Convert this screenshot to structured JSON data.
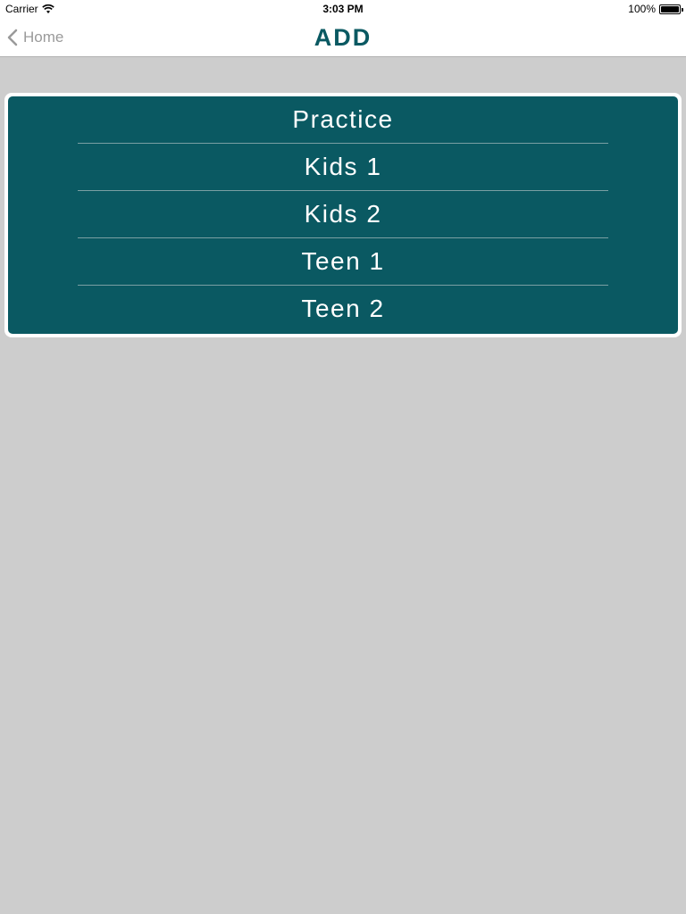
{
  "status_bar": {
    "carrier": "Carrier",
    "time": "3:03 PM",
    "battery": "100%"
  },
  "nav": {
    "back_label": "Home",
    "title": "ADD"
  },
  "menu": {
    "items": [
      {
        "label": "Practice"
      },
      {
        "label": "Kids 1"
      },
      {
        "label": "Kids 2"
      },
      {
        "label": "Teen 1"
      },
      {
        "label": "Teen 2"
      }
    ]
  },
  "colors": {
    "accent": "#0a5962",
    "background": "#cdcdcd",
    "back_text": "#9a9a9a"
  }
}
